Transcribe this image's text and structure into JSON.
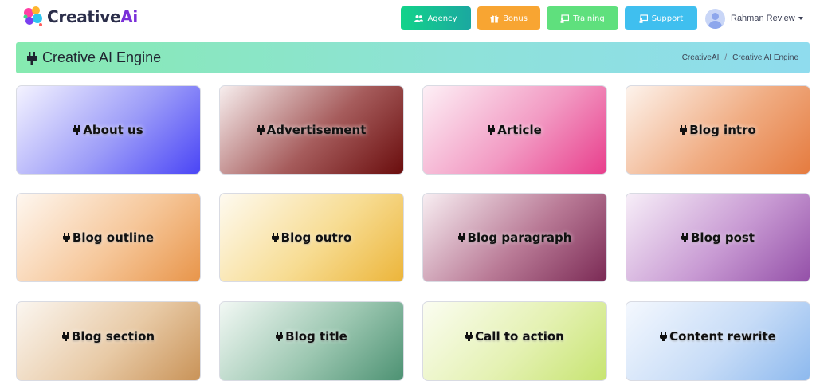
{
  "app": {
    "logo_main": "Creative",
    "logo_accent": "Ai"
  },
  "nav": {
    "agency": "Agency",
    "bonus": "Bonus",
    "training": "Training",
    "support": "Support"
  },
  "user": {
    "name": "Rahman Review"
  },
  "header": {
    "title": "Creative AI Engine",
    "breadcrumb": [
      "CreativeAI",
      "/",
      "Creative AI Engine"
    ]
  },
  "cards": [
    {
      "label": "About us"
    },
    {
      "label": "Advertisement"
    },
    {
      "label": "Article"
    },
    {
      "label": "Blog intro"
    },
    {
      "label": "Blog outline"
    },
    {
      "label": "Blog outro"
    },
    {
      "label": "Blog paragraph"
    },
    {
      "label": "Blog post"
    },
    {
      "label": "Blog section"
    },
    {
      "label": "Blog title"
    },
    {
      "label": "Call to action"
    },
    {
      "label": "Content rewrite"
    }
  ],
  "colors": {
    "agency": "#12d38a",
    "bonus": "#f8a532",
    "training": "#5fe07d",
    "support": "#3fbfef"
  }
}
